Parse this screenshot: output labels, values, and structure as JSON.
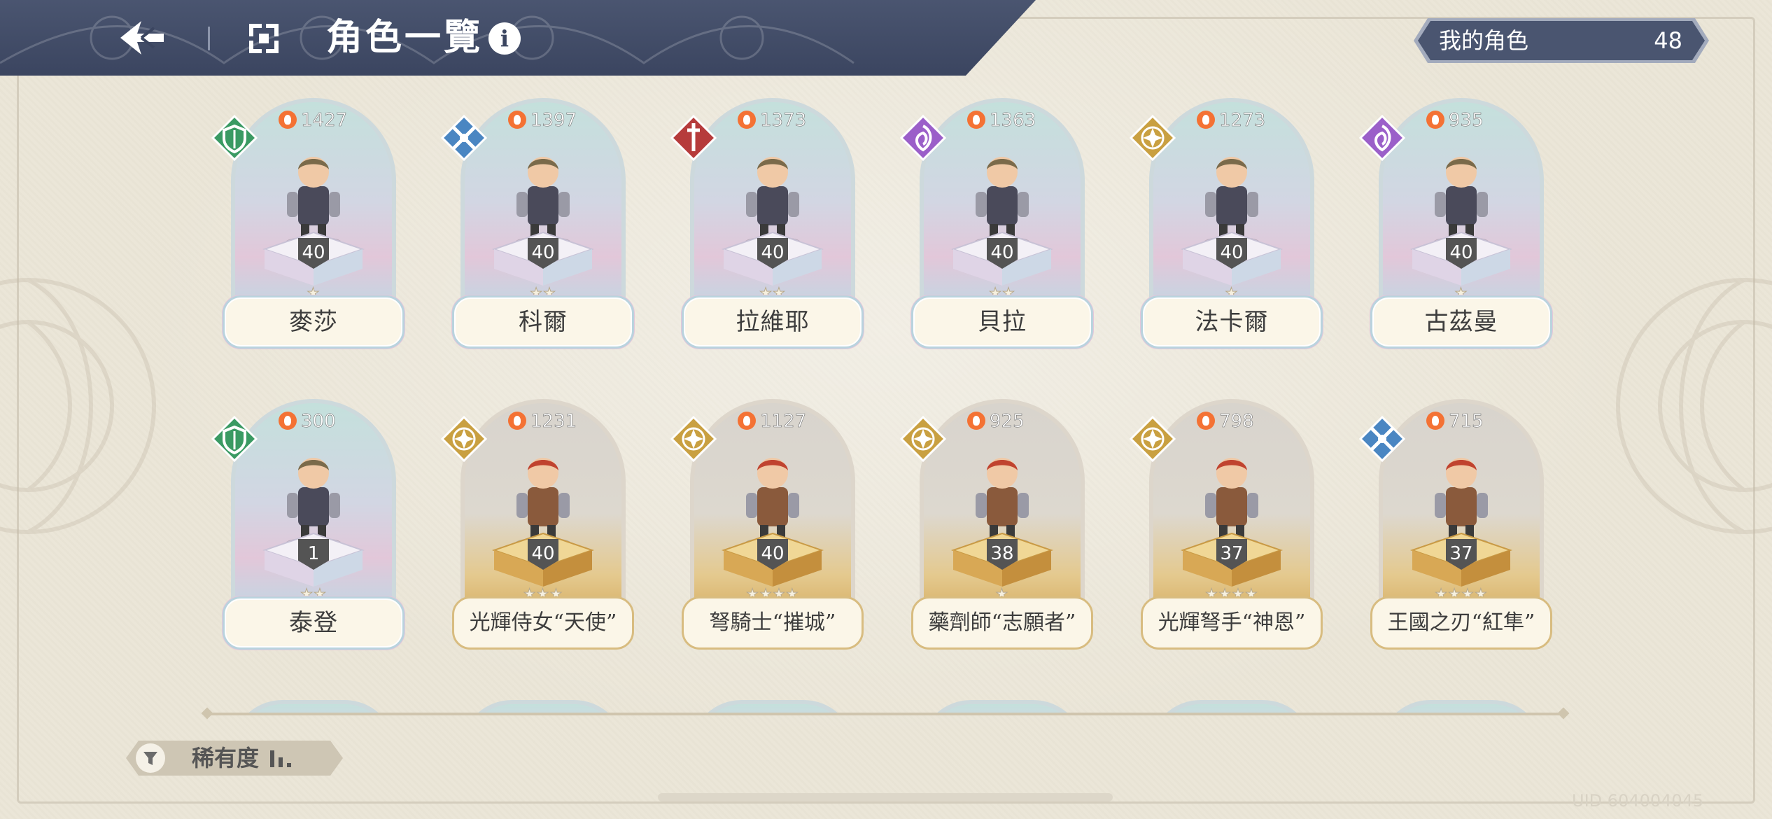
{
  "header": {
    "title": "角色一覽",
    "info_label": "i",
    "my_characters_label": "我的角色",
    "my_characters_count": "48"
  },
  "characters": [
    {
      "name": "麥莎",
      "power": "1427",
      "level": "40",
      "stars": "★",
      "class": "shield-class",
      "bg": "holo"
    },
    {
      "name": "科爾",
      "power": "1397",
      "level": "40",
      "stars": "★★",
      "class": "swords-class",
      "bg": "holo"
    },
    {
      "name": "拉維耶",
      "power": "1373",
      "level": "40",
      "stars": "★★",
      "class": "sword-class",
      "bg": "holo"
    },
    {
      "name": "貝拉",
      "power": "1363",
      "level": "40",
      "stars": "★★",
      "class": "magic-class",
      "bg": "holo"
    },
    {
      "name": "法卡爾",
      "power": "1273",
      "level": "40",
      "stars": "★",
      "class": "star-class",
      "bg": "holo"
    },
    {
      "name": "古茲曼",
      "power": "935",
      "level": "40",
      "stars": "★",
      "class": "magic-class",
      "bg": "holo"
    },
    {
      "name": "泰登",
      "power": "300",
      "level": "1",
      "stars": "★★",
      "class": "shield-class",
      "bg": "holo"
    },
    {
      "name": "光輝侍女“天使”",
      "power": "1231",
      "level": "40",
      "stars": "★★★",
      "class": "star-class",
      "bg": "gold"
    },
    {
      "name": "弩騎士“摧城”",
      "power": "1127",
      "level": "40",
      "stars": "★★★★",
      "class": "star-class",
      "bg": "gold"
    },
    {
      "name": "藥劑師“志願者”",
      "power": "925",
      "level": "38",
      "stars": "★",
      "class": "star-class",
      "bg": "gold"
    },
    {
      "name": "光輝弩手“神恩”",
      "power": "798",
      "level": "37",
      "stars": "★★★★",
      "class": "star-class",
      "bg": "gold"
    },
    {
      "name": "王國之刃“紅隼”",
      "power": "715",
      "level": "37",
      "stars": "★★★★",
      "class": "swords-class",
      "bg": "gold"
    }
  ],
  "filter": {
    "label": "稀有度"
  },
  "uid": "UID 604004045",
  "colors": {
    "header": "#3b4560",
    "shield": "#3a9a63",
    "swords": "#4a86c2",
    "sword": "#b63b3b",
    "magic": "#9b5fc9",
    "star": "#c9a041",
    "flame": "#f47234"
  }
}
